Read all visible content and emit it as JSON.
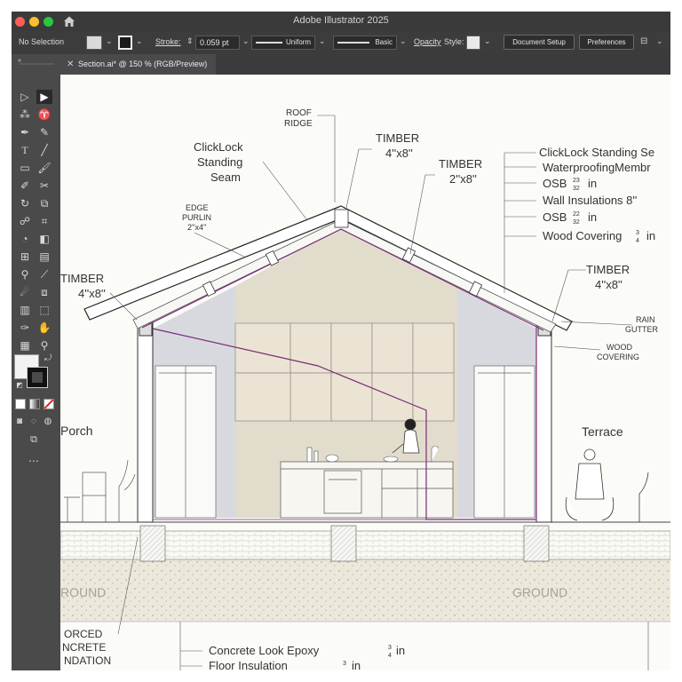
{
  "app": {
    "title": "Adobe Illustrator 2025"
  },
  "control_bar": {
    "selection": "No Selection",
    "stroke_label": "Stroke:",
    "stroke_value": "0.059 pt",
    "profile": "Uniform",
    "brush": "Basic",
    "opacity_label": "Opacity",
    "style_label": "Style:",
    "document_setup": "Document Setup",
    "preferences": "Preferences"
  },
  "document_tab": {
    "label": "Section.ai* @ 150 % (RGB/Preview)"
  },
  "icons": [
    "home-icon",
    "close-icon",
    "chevron-down-icon",
    "selection-tool-icon",
    "direct-selection-tool-icon",
    "pen-tool-icon",
    "type-tool-icon",
    "rectangle-tool-icon",
    "rotate-tool-icon",
    "zoom-tool-icon",
    "hand-tool-icon",
    "artboard-tool-icon",
    "swap-colors-icon",
    "more-tools-icon"
  ],
  "colors": {
    "accent_line": "#7b2d7a",
    "interior": "#ded8c8",
    "side_wall": "#d6d6dc",
    "ground": "#e8e3d6",
    "window_chrome": "#3a3a3a"
  },
  "drawing": {
    "roof_ridge": "ROOF\nRIDGE",
    "clicklock": "ClickLock\nStanding\nSeam",
    "timber_ridge": "TIMBER\n4''x8''",
    "timber_rafter": "TIMBER\n2''x8''",
    "edge_purlin": "EDGE\nPURLIN\n2''x4''",
    "timber_left": "TIMBER\n4''x8''",
    "timber_right": "TIMBER\n4''x8''",
    "rain_gutter": "RAIN\nGUTTER",
    "wood_covering_label": "WOOD\nCOVERING",
    "layers": [
      {
        "text": "ClickLock Standing Se"
      },
      {
        "text": "WaterproofingMembr"
      },
      {
        "text": "OSB",
        "num": "23",
        "den": "32",
        "unit": "in"
      },
      {
        "text": "Wall Insulations  8''"
      },
      {
        "text": "OSB",
        "num": "22",
        "den": "32",
        "unit": "in"
      },
      {
        "text": "Wood Covering",
        "num": "3",
        "den": "4",
        "unit": "in"
      }
    ],
    "porch": "Porch",
    "terrace": "Terrace",
    "ground_left": "ROUND",
    "ground_right": "GROUND",
    "foundation": "ORCED\nNCRETE\nNDATION",
    "bottom_notes": [
      {
        "text": "Concrete Look Epoxy",
        "num": "3",
        "den": "4",
        "unit": "in"
      },
      {
        "text": "Floor Insulation",
        "num": "3",
        "den": "",
        "unit": "in"
      }
    ]
  }
}
